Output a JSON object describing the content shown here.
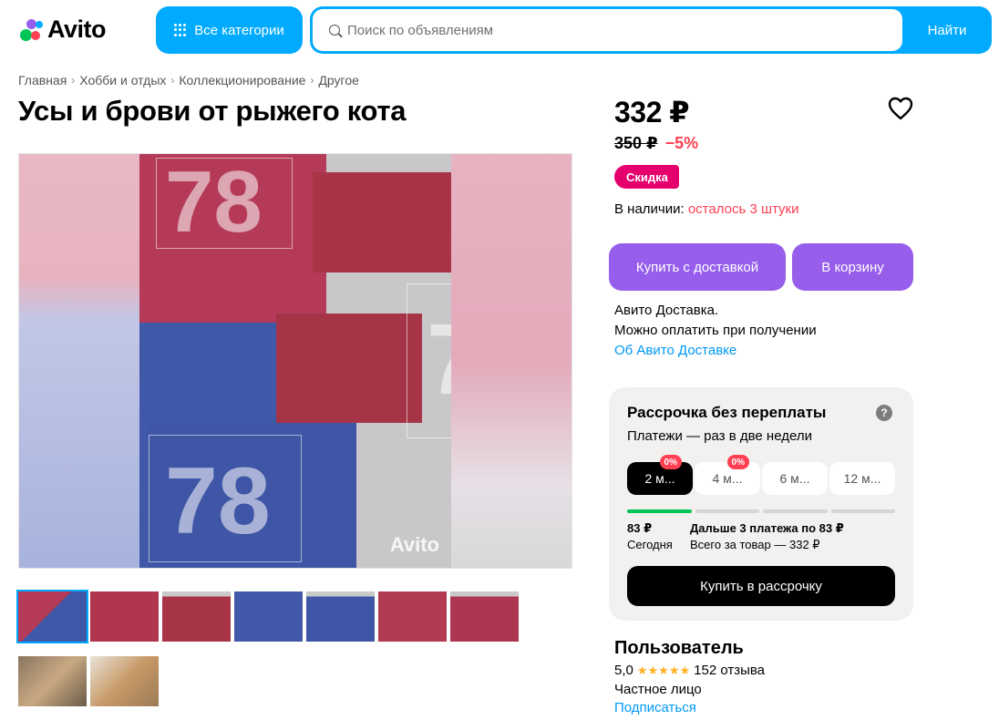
{
  "header": {
    "logo_text": "Avito",
    "categories_label": "Все категории",
    "search_placeholder": "Поиск по объявлениям",
    "search_value": "",
    "search_button": "Найти"
  },
  "breadcrumb": [
    "Главная",
    "Хобби и отдых",
    "Коллекционирование",
    "Другое"
  ],
  "listing": {
    "title": "Усы и брови от рыжего кота",
    "watermark": "78",
    "photo_watermark": "Avito"
  },
  "pricing": {
    "price": "332 ₽",
    "old_price": "350 ₽",
    "discount": "−5%",
    "sale_badge": "Скидка",
    "stock_label": "В наличии:",
    "stock_value": "осталось 3 штуки"
  },
  "actions": {
    "buy_delivery": "Купить с доставкой",
    "to_cart": "В корзину"
  },
  "delivery": {
    "line1": "Авито Доставка.",
    "line2": "Можно оплатить при получении",
    "link": "Об Авито Доставке"
  },
  "installment": {
    "title": "Рассрочка без переплаты",
    "help": "?",
    "subtitle": "Платежи — раз в две недели",
    "terms": [
      {
        "label": "2 м...",
        "badge": "0%",
        "active": true
      },
      {
        "label": "4 м...",
        "badge": "0%",
        "active": false
      },
      {
        "label": "6 м...",
        "badge": "",
        "active": false
      },
      {
        "label": "12 м...",
        "badge": "",
        "active": false
      }
    ],
    "first_amount": "83 ₽",
    "first_label": "Сегодня",
    "rest_amount": "Дальше 3 платежа по 83 ₽",
    "total_label": "Всего за товар — 332 ₽",
    "button": "Купить в рассрочку"
  },
  "seller": {
    "name": "Пользователь",
    "rating": "5,0",
    "stars": "★★★★★",
    "reviews": "152 отзыва",
    "type": "Частное лицо",
    "subscribe": "Подписаться"
  },
  "colors": {
    "brand_blue": "#00aaff",
    "purple": "#965eeb",
    "sale_pink": "#e6006e",
    "discount_red": "#ff4053",
    "link_blue": "#0099f7"
  }
}
